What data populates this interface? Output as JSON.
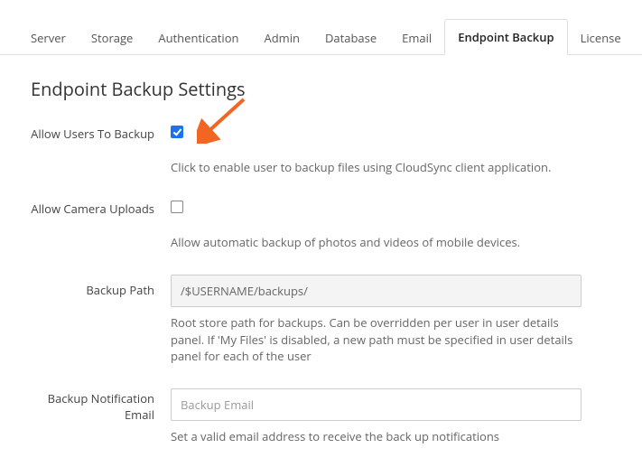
{
  "tabs": [
    {
      "label": "Server"
    },
    {
      "label": "Storage"
    },
    {
      "label": "Authentication"
    },
    {
      "label": "Admin"
    },
    {
      "label": "Database"
    },
    {
      "label": "Email"
    },
    {
      "label": "Endpoint Backup",
      "active": true
    },
    {
      "label": "License"
    }
  ],
  "heading": "Endpoint Backup Settings",
  "fields": {
    "allow_backup": {
      "label": "Allow Users To Backup",
      "checked": true,
      "desc": "Click to enable user to backup files using CloudSync client application."
    },
    "camera_uploads": {
      "label": "Allow Camera Uploads",
      "checked": false,
      "desc": "Allow automatic backup of photos and videos of mobile devices."
    },
    "backup_path": {
      "label": "Backup Path",
      "value": "/$USERNAME/backups/",
      "desc": "Root store path for backups. Can be overridden per user in user details panel. If 'My Files' is disabled, a new path must be specified in user details panel for each of the user"
    },
    "notif_email": {
      "label": "Backup Notification Email",
      "placeholder": "Backup Email",
      "value": "",
      "desc": "Set a valid email address to receive the back up notifications"
    }
  },
  "annotation": {
    "arrow_color": "#f26522"
  }
}
